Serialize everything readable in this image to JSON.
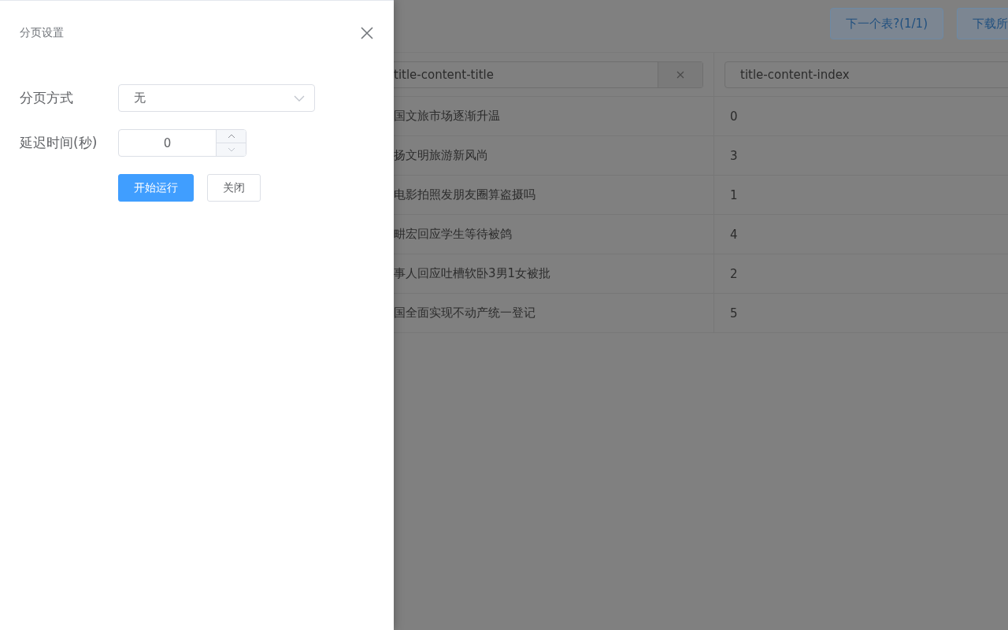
{
  "drawer": {
    "title": "分页设置",
    "fields": [
      {
        "kind": "select",
        "label": "分页方式",
        "value": "无"
      },
      {
        "kind": "number",
        "label": "延迟时间(秒)",
        "value": "0"
      }
    ],
    "buttons": [
      {
        "kind": "primary",
        "label": "开始运行"
      },
      {
        "kind": "default",
        "label": "关闭"
      }
    ]
  },
  "background": {
    "toolbar_buttons": [
      "下一个表?(1/1)",
      "下载所"
    ],
    "table": {
      "columns": [
        {
          "value": "title-content-title",
          "clearable": true
        },
        {
          "value": "title-content-index",
          "clearable": false
        }
      ],
      "rows": [
        [
          "国文旅市场逐渐升温",
          "0"
        ],
        [
          "扬文明旅游新风尚",
          "3"
        ],
        [
          "电影拍照发朋友圈算盗摄吗",
          "1"
        ],
        [
          "畊宏回应学生等待被鸽",
          "4"
        ],
        [
          "事人回应吐槽软卧3男1女被批",
          "2"
        ],
        [
          "国全面实现不动产统一登记",
          "5"
        ]
      ]
    }
  }
}
